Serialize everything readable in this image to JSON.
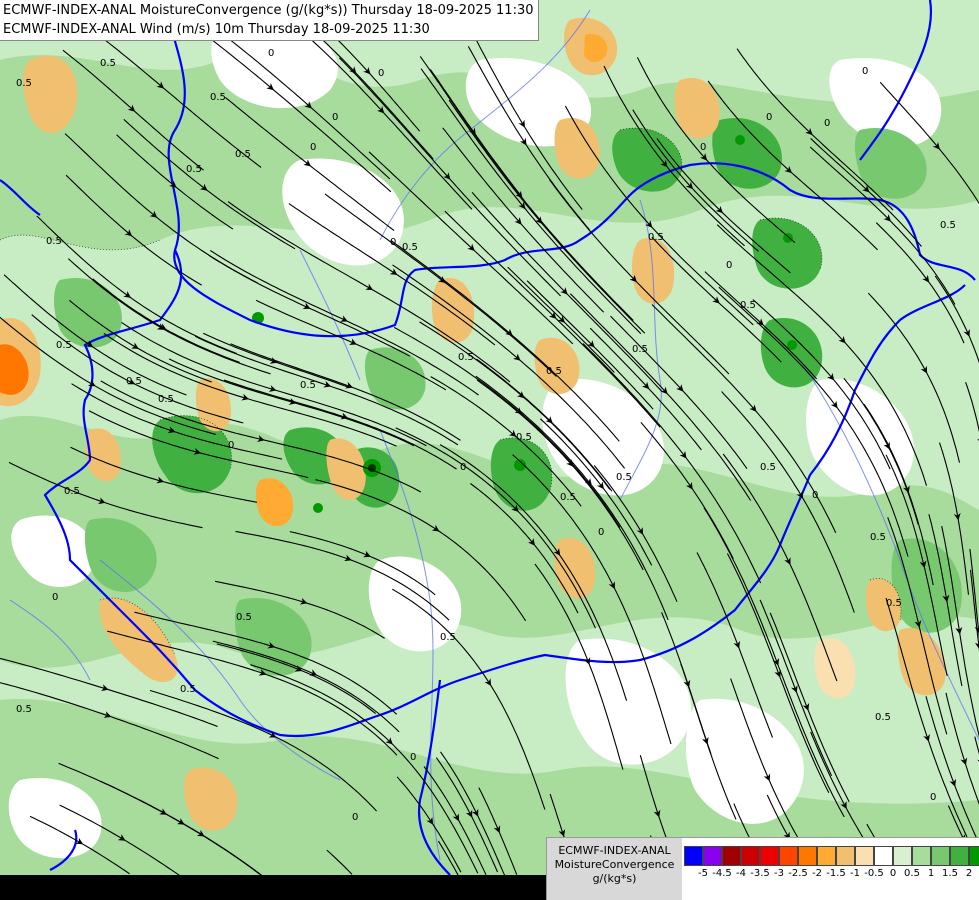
{
  "header": {
    "line1": "ECMWF-INDEX-ANAL MoistureConvergence (g/(kg*s)) Thursday 18-09-2025 11:30",
    "line2": "ECMWF-INDEX-ANAL Wind (m/s) 10m Thursday 18-09-2025 11:30"
  },
  "legend": {
    "name1": "ECMWF-INDEX-ANAL",
    "name2": "MoistureConvergence",
    "unit": "g/(kg*s)",
    "colors": [
      "#0000ff",
      "#8800ee",
      "#a00000",
      "#cc0000",
      "#ee0000",
      "#ff4400",
      "#ff7700",
      "#ffaa33",
      "#f0c070",
      "#fae0b0",
      "#ffffff",
      "#d8f0d0",
      "#a8dc9c",
      "#78c870",
      "#40b040",
      "#009900"
    ],
    "ticks": [
      "-5",
      "-4.5",
      "-4",
      "-3.5",
      "-3",
      "-2.5",
      "-2",
      "-1.5",
      "-1",
      "-0.5",
      "0",
      "0.5",
      "1",
      "1.5",
      "2"
    ]
  },
  "map": {
    "contour_labels": [
      "0",
      "0.5",
      "-0.5"
    ],
    "colors": {
      "border": "#0000ff",
      "river": "#5a6cff",
      "streamline": "#000000"
    }
  }
}
